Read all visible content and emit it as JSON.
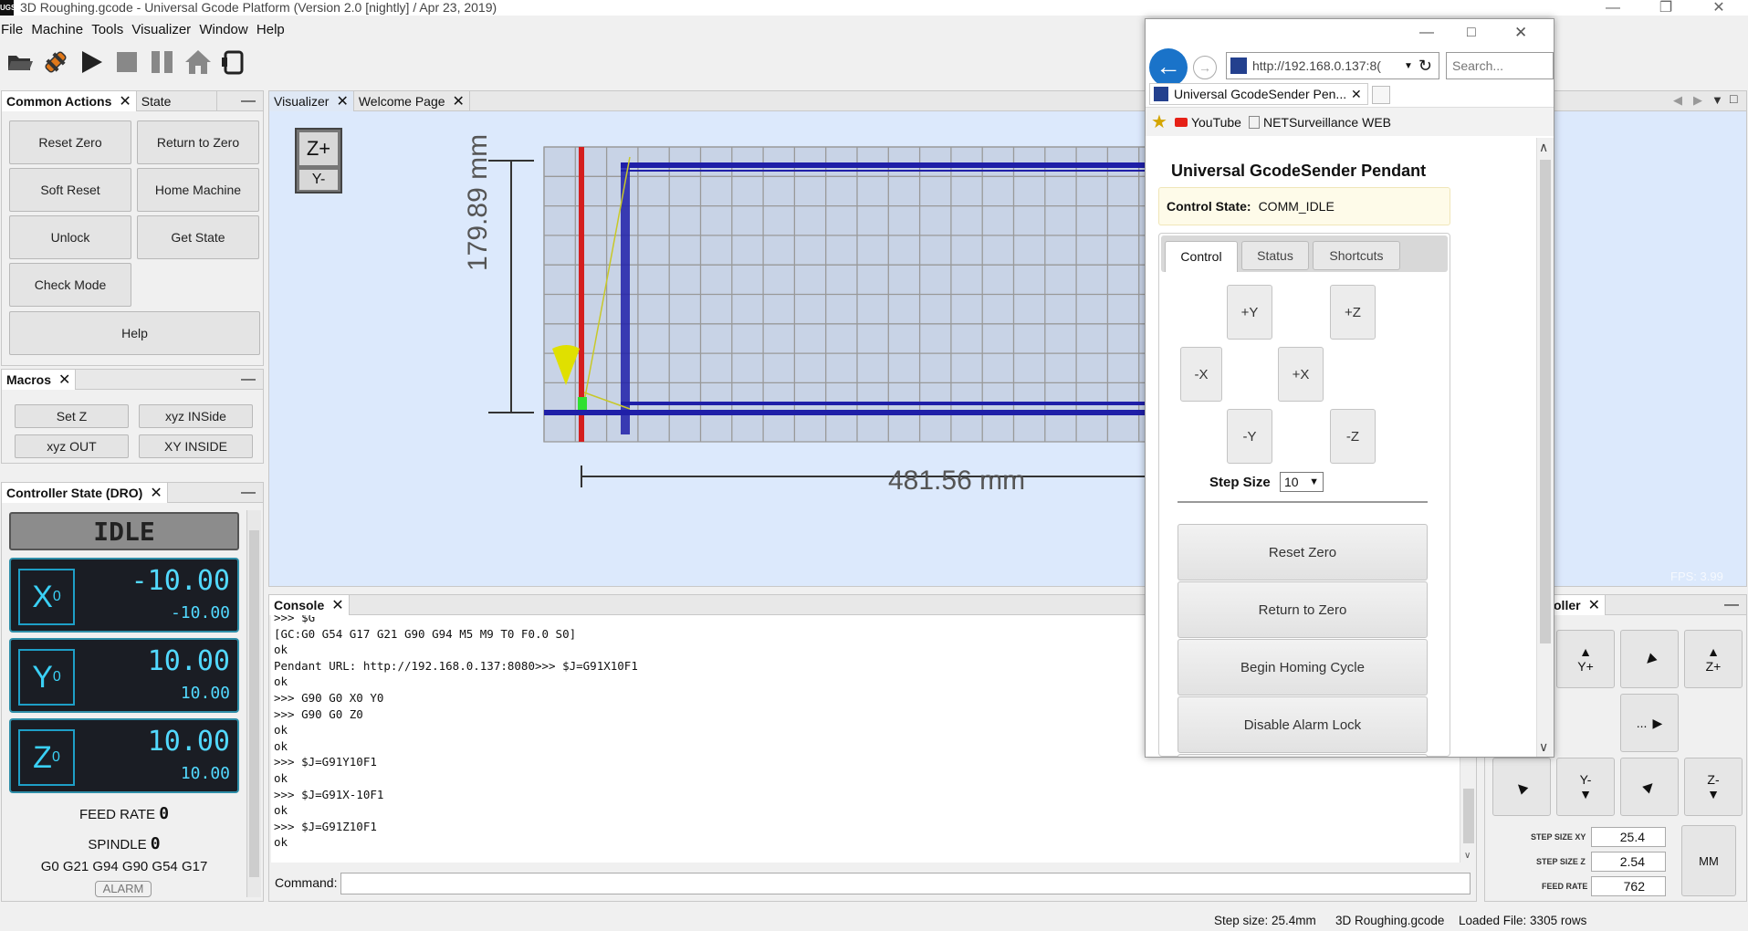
{
  "window": {
    "app_badge": "UGS",
    "title": "3D Roughing.gcode - Universal Gcode Platform (Version 2.0 [nightly]  / Apr 23, 2019)"
  },
  "menu": [
    "File",
    "Machine",
    "Tools",
    "Visualizer",
    "Window",
    "Help"
  ],
  "toolbar_icons": [
    "open-folder-icon",
    "connect-plug-icon",
    "play-icon",
    "stop-icon",
    "pause-icon",
    "home-icon",
    "pendant-icon"
  ],
  "common_actions": {
    "tabs": [
      "Common Actions",
      "State"
    ],
    "buttons": [
      "Reset Zero",
      "Return to Zero",
      "Soft Reset",
      "Home Machine",
      "Unlock",
      "Get State",
      "Check Mode",
      "Help"
    ]
  },
  "macros": {
    "tab": "Macros",
    "buttons": [
      "Set Z",
      "xyz INSide",
      "xyz OUT",
      "XY INSIDE"
    ]
  },
  "dro": {
    "tab": "Controller State (DRO)",
    "state": "IDLE",
    "axes": [
      {
        "name": "X",
        "sub": "0",
        "work": "-10.00",
        "machine": "-10.00"
      },
      {
        "name": "Y",
        "sub": "0",
        "work": "10.00",
        "machine": "10.00"
      },
      {
        "name": "Z",
        "sub": "0",
        "work": "10.00",
        "machine": "10.00"
      }
    ],
    "feed_rate_label": "FEED RATE",
    "feed_rate_value": "0",
    "spindle_label": "SPINDLE",
    "spindle_value": "0",
    "gcode_state": "G0 G21 G94 G90 G54 G17",
    "alarm_label": "ALARM"
  },
  "visualizer": {
    "tabs": [
      "Visualizer",
      "Welcome Page"
    ],
    "zplus": "Z+",
    "yminus": "Y-",
    "height_dim": "179.89 mm",
    "width_dim": "481.56 mm",
    "fps": "FPS: 3.99"
  },
  "console": {
    "tab": "Console",
    "lines": [
      ">>> $G",
      "[GC:G0 G54 G17 G21 G90 G94 M5 M9 T0 F0.0 S0]",
      "ok",
      "Pendant URL: http://192.168.0.137:8080>>> $J=G91X10F1",
      "ok",
      ">>> G90 G0 X0 Y0",
      ">>> G90 G0 Z0",
      "ok",
      "ok",
      ">>> $J=G91Y10F1",
      "ok",
      ">>> $J=G91X-10F1",
      "ok",
      ">>> $J=G91Z10F1",
      "ok"
    ],
    "command_label": "Command:"
  },
  "jog": {
    "tab": "oller",
    "yplus": "Y+",
    "zplus": "Z+",
    "yminus": "Y-",
    "zminus": "Z-",
    "more": "...",
    "step_xy_label": "STEP SIZE XY",
    "step_xy": "25.4",
    "step_z_label": "STEP SIZE Z",
    "step_z": "2.54",
    "feed_label": "FEED RATE",
    "feed": "762",
    "units": "MM"
  },
  "statusbar": {
    "step_size": "Step size: 25.4mm",
    "file": "3D Roughing.gcode",
    "loaded": "Loaded File: 3305 rows"
  },
  "browser": {
    "url": "http://192.168.0.137:8(",
    "search_placeholder": "Search...",
    "tab_title": "Universal GcodeSender Pen...",
    "favorites": [
      "YouTube",
      "NETSurveillance WEB"
    ],
    "pendant": {
      "heading": "Universal GcodeSender Pendant",
      "control_state_label": "Control State:",
      "control_state": "COMM_IDLE",
      "tabs": [
        "Control",
        "Status",
        "Shortcuts"
      ],
      "jog": {
        "yplus": "+Y",
        "zplus": "+Z",
        "xminus": "-X",
        "xplus": "+X",
        "yminus": "-Y",
        "zminus": "-Z"
      },
      "step_size_label": "Step Size",
      "step_size": "10",
      "actions": [
        "Reset Zero",
        "Return to Zero",
        "Begin Homing Cycle",
        "Disable Alarm Lock"
      ]
    }
  }
}
